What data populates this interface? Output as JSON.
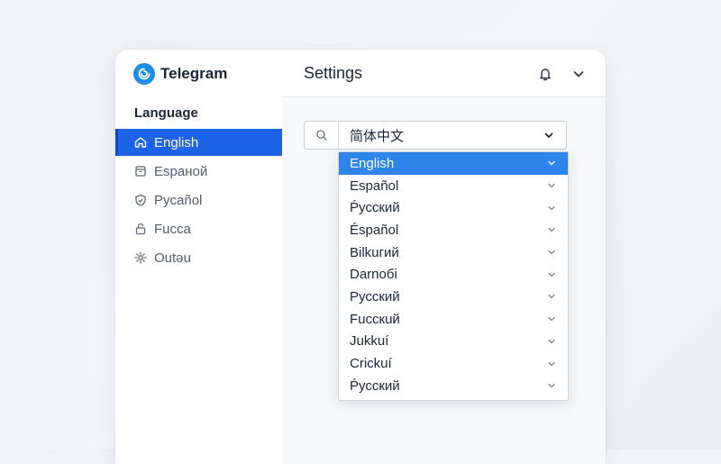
{
  "app": {
    "name": "Telegram"
  },
  "sidebar": {
    "section_title": "Language",
    "items": [
      {
        "label": "English",
        "icon": "home-icon",
        "active": true
      },
      {
        "label": "Espaной",
        "icon": "box-icon",
        "active": false
      },
      {
        "label": "Рycañol",
        "icon": "shield-icon",
        "active": false
      },
      {
        "label": "Fucca",
        "icon": "lock-icon",
        "active": false
      },
      {
        "label": "Outəu",
        "icon": "gear-icon",
        "active": false
      }
    ]
  },
  "header": {
    "title": "Settings"
  },
  "language_select": {
    "value": "简体中文",
    "options": [
      {
        "label": "English",
        "selected": true
      },
      {
        "label": "Español",
        "selected": false
      },
      {
        "label": "Ṕусский",
        "selected": false
      },
      {
        "label": "Éspañol",
        "selected": false
      },
      {
        "label": "Bilkuгий",
        "selected": false
      },
      {
        "label": "Darnoбi",
        "selected": false
      },
      {
        "label": "Русский",
        "selected": false
      },
      {
        "label": "Fucскuй",
        "selected": false
      },
      {
        "label": "Jukkuí",
        "selected": false
      },
      {
        "label": "Crickuí",
        "selected": false
      },
      {
        "label": "Ṕусский",
        "selected": false
      }
    ]
  },
  "colors": {
    "accent": "#1d63e8",
    "selected_option": "#2f86ea",
    "brand_logo": "#1f8fe6"
  }
}
